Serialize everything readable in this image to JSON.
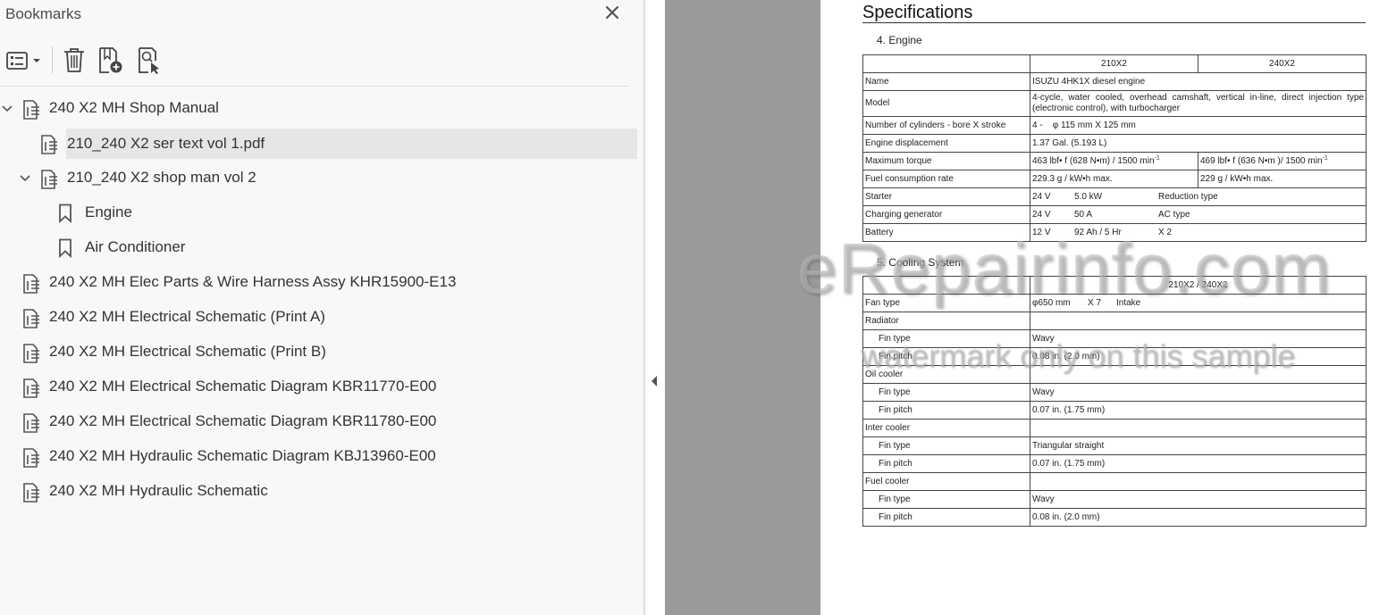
{
  "bookmarks_panel": {
    "title": "Bookmarks",
    "toolbar": {
      "options": "bookmark-options-icon",
      "delete": "trash-icon",
      "new": "new-bookmark-icon",
      "find": "find-bookmark-icon"
    },
    "items": [
      {
        "label": "240 X2 MH Shop Manual",
        "expanded": true
      },
      {
        "label": "210_240 X2 ser text vol 1.pdf",
        "selected": true
      },
      {
        "label": "210_240 X2 shop man vol 2",
        "expanded": true
      },
      {
        "label": "Engine"
      },
      {
        "label": "Air Conditioner"
      },
      {
        "label": "240 X2 MH Elec Parts & Wire Harness Assy KHR15900-E13"
      },
      {
        "label": "240 X2 MH Electrical Schematic (Print A)"
      },
      {
        "label": "240 X2 MH Electrical Schematic (Print B)"
      },
      {
        "label": "240 X2 MH Electrical Schematic Diagram KBR11770-E00"
      },
      {
        "label": "240 X2 MH Electrical Schematic Diagram KBR11780-E00"
      },
      {
        "label": "240 X2 MH Hydraulic Schematic Diagram KBJ13960-E00"
      },
      {
        "label": "240 X2 MH Hydraulic Schematic"
      }
    ]
  },
  "document": {
    "title": "Specifications",
    "engine": {
      "heading": "4. Engine",
      "col_a": "210X2",
      "col_b": "240X2",
      "name_label": "Name",
      "name_value": "ISUZU 4HK1X diesel engine",
      "model_label": "Model",
      "model_value": "4-cycle, water cooled, overhead camshaft, vertical in-line, direct injection type (electronic control), with turbocharger",
      "cyl_label": "Number of cylinders - bore X stroke",
      "cyl_value": "4 -    φ 115 mm X 125 mm",
      "disp_label": "Engine displacement",
      "disp_value": "1.37 Gal. (5.193 L)",
      "torque_label": "Maximum torque",
      "torque_a": "463 lbf• f (628 N•m) / 1500 min",
      "torque_b": "469 lbf• f (636 N•m )/ 1500 min",
      "torque_exp": "-1",
      "fuel_label": "Fuel consumption rate",
      "fuel_a": "229.3 g / kW•h max.",
      "fuel_b": "229 g / kW•h max.",
      "starter_label": "Starter",
      "starter_v": "24 V",
      "starter_p": "5.0 kW",
      "starter_t": "Reduction type",
      "gen_label": "Charging generator",
      "gen_v": "24 V",
      "gen_a": "50 A",
      "gen_t": "AC type",
      "bat_label": "Battery",
      "bat_v": "12 V",
      "bat_c": "92 Ah / 5 Hr",
      "bat_n": "X 2"
    },
    "cooling": {
      "heading": "5. Cooling System",
      "col": "210X2 / 240X2",
      "fan_label": "Fan type",
      "fan_d": "φ650 mm",
      "fan_n": "X 7",
      "fan_t": "Intake",
      "radiator": "Radiator",
      "oil_cooler": "Oil cooler",
      "inter_cooler": "Inter cooler",
      "fuel_cooler": "Fuel cooler",
      "fin_type": "Fin type",
      "fin_pitch": "Fin pitch",
      "rad_type": "Wavy",
      "rad_pitch": "0.08 in. (2.0 mm)",
      "oil_type": "Wavy",
      "oil_pitch": "0.07 in. (1.75 mm)",
      "inter_type": "Triangular straight",
      "inter_pitch": "0.07 in. (1.75 mm)",
      "fuel_type": "Wavy",
      "fuel_pitch": "0.08 in. (2.0 mm)"
    },
    "watermark_1": "eRepairinfo.com",
    "watermark_2": "watermark only on this sample"
  },
  "colors": {
    "panel_bg": "#f8f8f8",
    "selected_row": "#e6e6e6",
    "gutter": "#9a9a9a"
  }
}
